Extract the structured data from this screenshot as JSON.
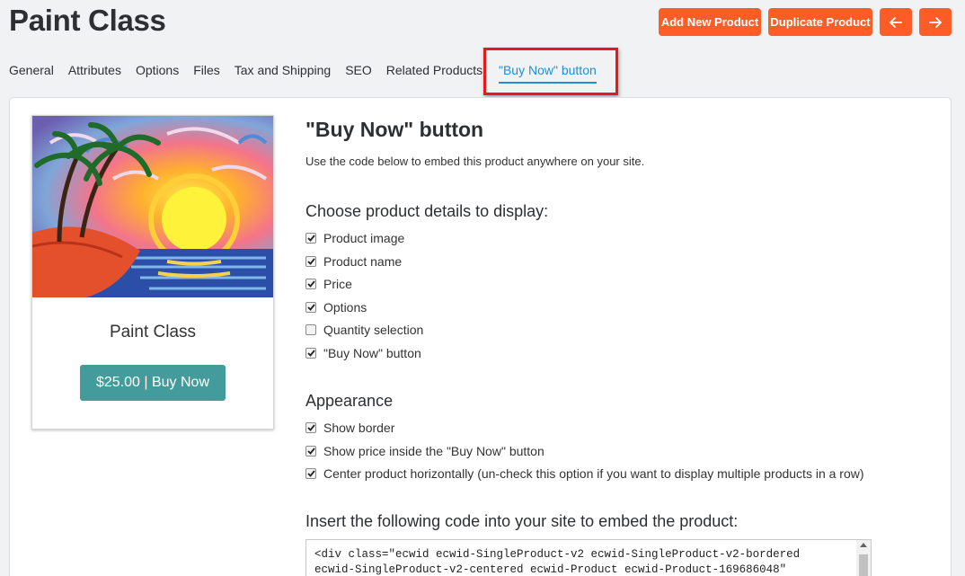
{
  "header": {
    "title": "Paint Class",
    "add_new_product_label": "Add New Product",
    "duplicate_product_label": "Duplicate Product"
  },
  "tabs": [
    {
      "label": "General"
    },
    {
      "label": "Attributes"
    },
    {
      "label": "Options"
    },
    {
      "label": "Files"
    },
    {
      "label": "Tax and Shipping"
    },
    {
      "label": "SEO"
    },
    {
      "label": "Related Products"
    }
  ],
  "active_tab": {
    "label": "\"Buy Now\" button"
  },
  "preview": {
    "product_name": "Paint Class",
    "buy_button_label": "$25.00 | Buy Now"
  },
  "section": {
    "title": "\"Buy Now\" button",
    "description": "Use the code below to embed this product anywhere on your site."
  },
  "details": {
    "heading": "Choose product details to display:",
    "options": [
      {
        "label": "Product image",
        "checked": true
      },
      {
        "label": "Product name",
        "checked": true
      },
      {
        "label": "Price",
        "checked": true
      },
      {
        "label": "Options",
        "checked": true
      },
      {
        "label": "Quantity selection",
        "checked": false
      },
      {
        "label": "\"Buy Now\" button",
        "checked": true
      }
    ]
  },
  "appearance": {
    "heading": "Appearance",
    "options": [
      {
        "label": "Show border",
        "checked": true
      },
      {
        "label": "Show price inside the \"Buy Now\" button",
        "checked": true
      },
      {
        "label": "Center product horizontally (un-check this option if you want to display multiple products in a row)",
        "checked": true
      }
    ]
  },
  "embed": {
    "heading": "Insert the following code into your site to embed the product:",
    "code": "<div class=\"ecwid ecwid-SingleProduct-v2 ecwid-SingleProduct-v2-bordered\necwid-SingleProduct-v2-centered ecwid-Product ecwid-Product-169686048\""
  },
  "colors": {
    "accent": "#ff5c28",
    "active_tab": "#1f8fd6",
    "buy_button": "#449b9b",
    "highlight": "#e41b1b"
  }
}
